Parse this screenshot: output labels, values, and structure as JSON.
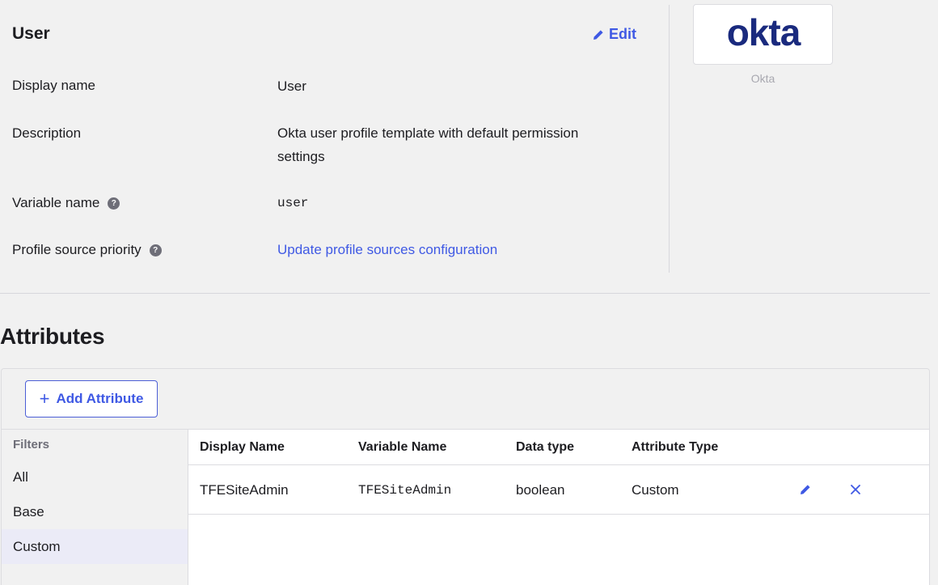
{
  "profile": {
    "title": "User",
    "edit_label": "Edit",
    "rows": {
      "display_name": {
        "label": "Display name",
        "value": "User"
      },
      "description": {
        "label": "Description",
        "value": "Okta user profile template with default permission settings"
      },
      "variable_name": {
        "label": "Variable name",
        "value": "user",
        "help_icon": "question-circle-icon"
      },
      "profile_source": {
        "label": "Profile source priority",
        "value": "Update profile sources configuration",
        "help_icon": "question-circle-icon"
      }
    }
  },
  "logo": {
    "wordmark": "okta",
    "caption": "Okta",
    "color": "#1a2a7e"
  },
  "attributes": {
    "heading": "Attributes",
    "add_button_label": "Add Attribute",
    "filters": {
      "title": "Filters",
      "items": [
        "All",
        "Base",
        "Custom"
      ],
      "selected": "Custom"
    },
    "table": {
      "columns": [
        "Display Name",
        "Variable Name",
        "Data type",
        "Attribute Type"
      ],
      "rows": [
        {
          "display_name": "TFESiteAdmin",
          "variable_name": "TFESiteAdmin",
          "data_type": "boolean",
          "attribute_type": "Custom",
          "actions": [
            "pencil-icon",
            "close-icon"
          ]
        }
      ]
    }
  },
  "colors": {
    "accent": "#3f59e4",
    "background": "#f1f1f1",
    "selected_filter": "#ebebf7"
  }
}
